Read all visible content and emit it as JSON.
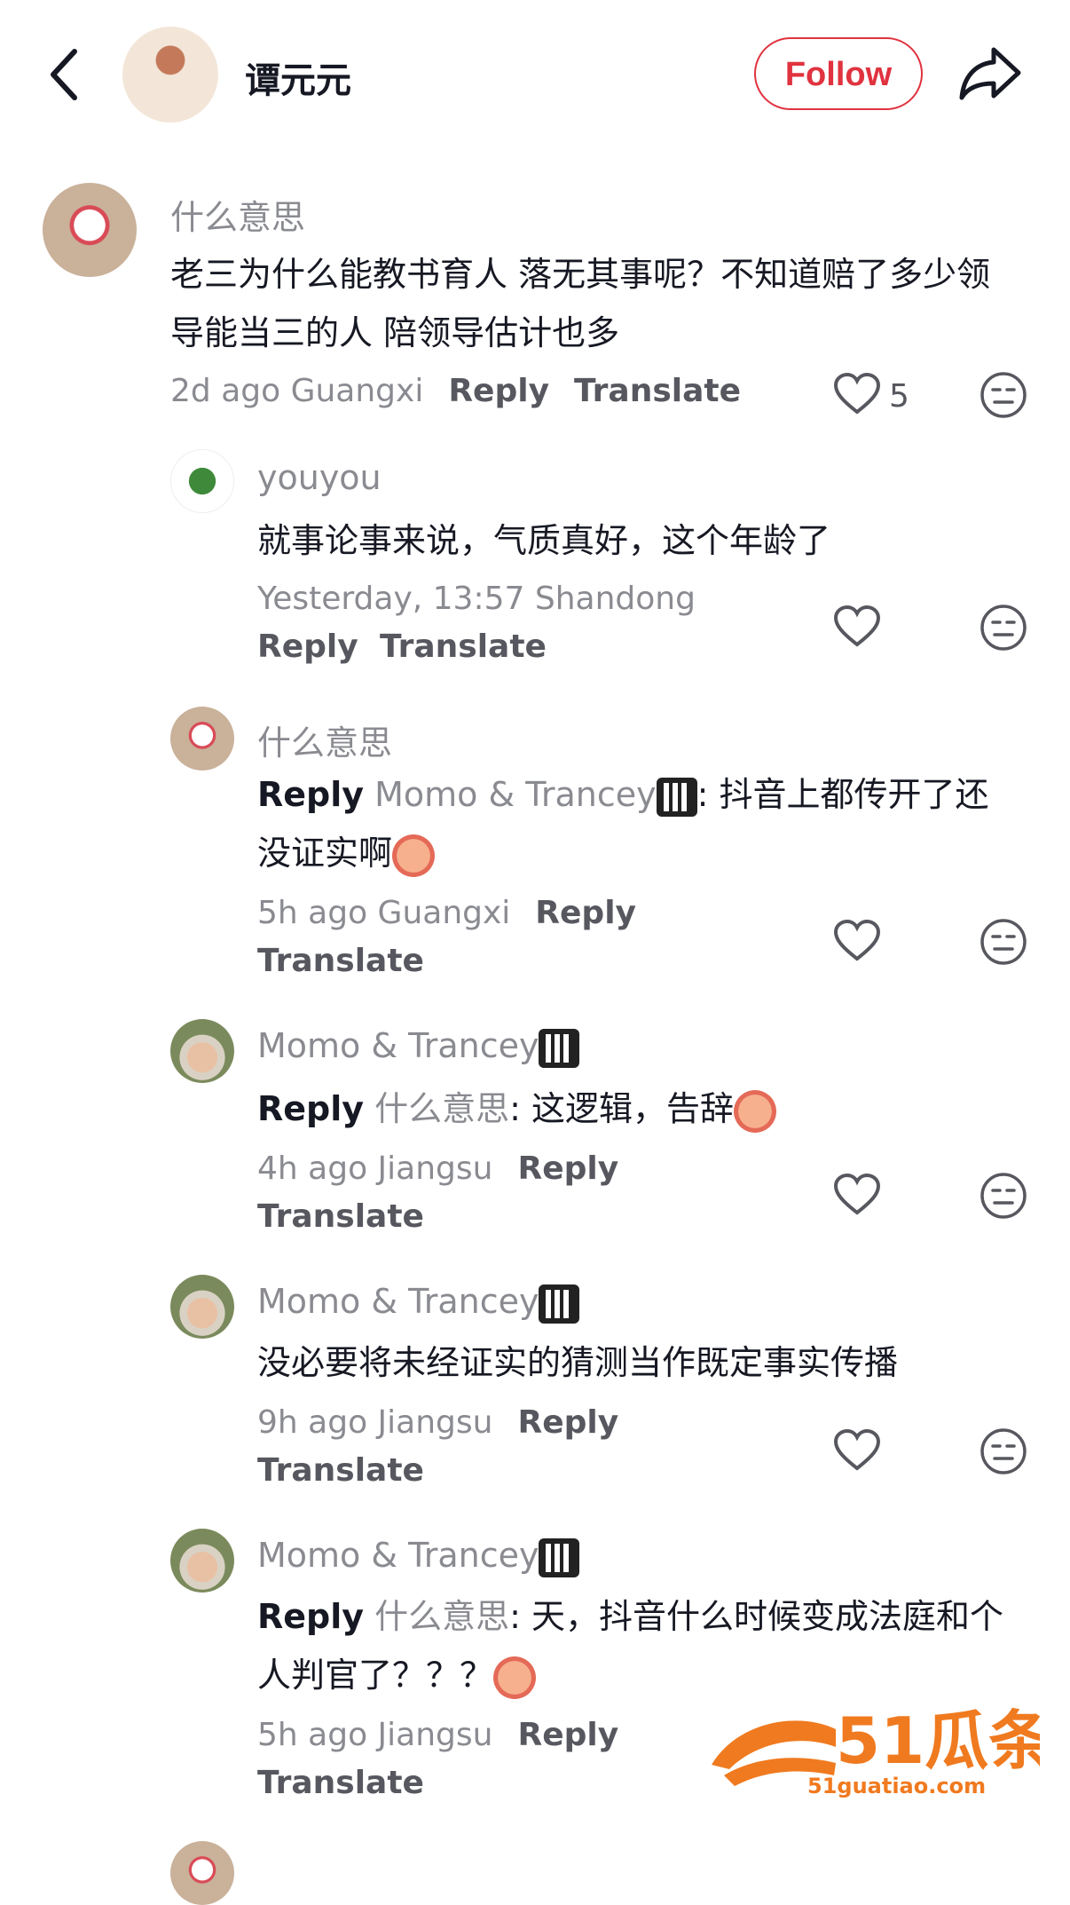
{
  "header": {
    "title": "谭元元",
    "follow_label": "Follow"
  },
  "comments": [
    {
      "author": "什么意思",
      "text": "老三为什么能教书育人 落无其事呢？不知道赔了多少领导能当三的人 陪领导估计也多",
      "meta": "2d ago Guangxi",
      "reply_label": "Reply",
      "translate_label": "Translate",
      "likes": "5"
    },
    {
      "author": "youyou",
      "text": "就事论事来说，气质真好，这个年龄了",
      "meta": "Yesterday, 13:57 Shandong",
      "reply_label": "Reply",
      "translate_label": "Translate"
    },
    {
      "author": "什么意思",
      "reply_prefix": "Reply",
      "reply_to": "Momo & Trancey",
      "text": ": 抖音上都传开了还没证实啊",
      "meta": "5h ago Guangxi",
      "reply_label": "Reply",
      "translate_label": "Translate"
    },
    {
      "author": "Momo & Trancey",
      "reply_prefix": "Reply",
      "reply_to": "什么意思",
      "text": ": 这逻辑，告辞",
      "meta": "4h ago Jiangsu",
      "reply_label": "Reply",
      "translate_label": "Translate"
    },
    {
      "author": "Momo & Trancey",
      "text": "没必要将未经证实的猜测当作既定事实传播",
      "meta": "9h ago Jiangsu",
      "reply_label": "Reply",
      "translate_label": "Translate"
    },
    {
      "author": "Momo & Trancey",
      "reply_prefix": "Reply",
      "reply_to": "什么意思",
      "text": ": 天，抖音什么时候变成法庭和个人判官了？？？",
      "meta": "5h ago Jiangsu",
      "reply_label": "Reply",
      "translate_label": "Translate"
    }
  ],
  "watermark": {
    "brand": "51瓜条",
    "url": "51guatiao.com"
  },
  "colors": {
    "accent": "#e0333f",
    "secondary_text": "#8a8b91",
    "watermark": "#f07a1f"
  },
  "icons": [
    "back-icon",
    "share-icon",
    "heart-icon",
    "dislike-icon",
    "piano-emoji",
    "crying-emoji"
  ]
}
